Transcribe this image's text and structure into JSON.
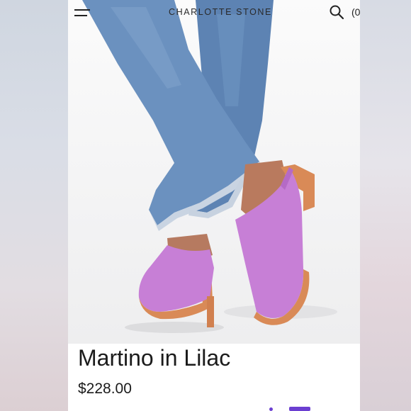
{
  "header": {
    "brand": "CHARLOTTE STONE",
    "menu_icon": "menu-icon",
    "search_icon": "search-icon",
    "cart_label": "(0"
  },
  "product": {
    "name": "Martino in Lilac",
    "price": "$228.00",
    "image_alt": "Model wearing lilac suede clogs with wooden heels and frayed denim jeans"
  },
  "colors": {
    "lilac": "#c77fd6",
    "wood": "#d98a57",
    "denim": "#5b82b2",
    "accent": "#6b3fd1"
  }
}
